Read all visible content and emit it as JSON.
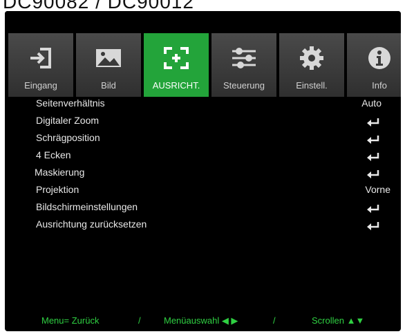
{
  "caption": "DC90082 / DC90012",
  "tabs": [
    {
      "label": "Eingang",
      "icon": "input-icon",
      "active": false
    },
    {
      "label": "Bild",
      "icon": "image-icon",
      "active": false
    },
    {
      "label": "AUSRICHT.",
      "icon": "alignment-icon",
      "active": true
    },
    {
      "label": "Steuerung",
      "icon": "sliders-icon",
      "active": false
    },
    {
      "label": "Einstell.",
      "icon": "gear-icon",
      "active": false
    },
    {
      "label": "Info",
      "icon": "info-icon",
      "active": false
    }
  ],
  "menu": [
    {
      "label": "Seitenverhältnis",
      "value": "Auto"
    },
    {
      "label": "Digitaler Zoom",
      "value": "enter-icon"
    },
    {
      "label": "Schrägposition",
      "value": "enter-icon"
    },
    {
      "label": "4 Ecken",
      "value": "enter-icon"
    },
    {
      "label": "Maskierung",
      "value": "enter-icon"
    },
    {
      "label": "Projektion",
      "value": "Vorne"
    },
    {
      "label": "Bildschirmeinstellungen",
      "value": "enter-icon"
    },
    {
      "label": "Ausrichtung zurücksetzen",
      "value": "enter-icon"
    }
  ],
  "footer": {
    "back": "Menu= Zurück",
    "sep1": "/",
    "select": "Menüauswahl ◀ ▶",
    "sep2": "/",
    "scroll": "Scrollen ▲▼"
  },
  "colors": {
    "active_tab": "#23a43a",
    "footer_text": "#2fd042",
    "background": "#000000"
  }
}
